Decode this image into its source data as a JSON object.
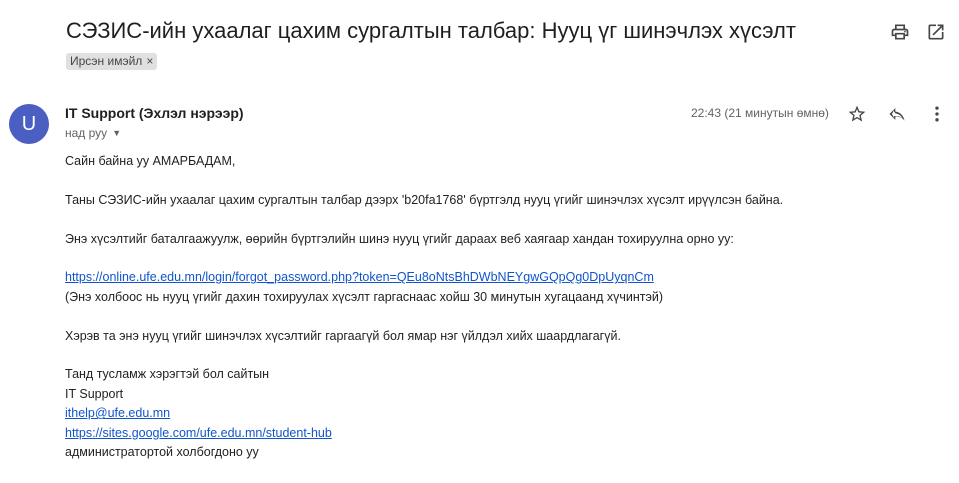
{
  "email": {
    "subject": "СЭЗИС-ийн ухаалаг цахим сургалтын талбар: Нууц үг шинэчлэх хүсэлт",
    "label_chip": "Ирсэн имэйл",
    "label_chip_remove": "×",
    "sender_initial": "U",
    "sender_name": "IT Support (Эхлэл нэрээр)",
    "to_text": "над руу",
    "timestamp": "22:43 (21 минутын өмнө)",
    "body": {
      "greeting": "Сайн байна уу АМАРБАДАМ,",
      "para1": "Таны СЭЗИС-ийн ухаалаг цахим сургалтын талбар дээрх 'b20fa1768' бүртгэлд нууц үгийг шинэчлэх хүсэлт ирүүлсэн байна.",
      "para2": "Энэ хүсэлтийг баталгаажуулж, өөрийн бүртгэлийн шинэ нууц үгийг дараах веб хаягаар хандан тохируулна орно уу:",
      "reset_link": "https://online.ufe.edu.mn/login/forgot_password.php?token=QEu8oNtsBhDWbNEYgwGQpQg0DpUyqnCm",
      "link_note": "(Энэ холбоос нь нууц үгийг дахин тохируулах хүсэлт гаргаснаас хойш 30 минутын хугацаанд хүчинтэй)",
      "para3": "Хэрэв та энэ нууц үгийг шинэчлэх хүсэлтийг гаргаагүй бол ямар нэг үйлдэл хийх шаардлагагүй.",
      "sig_line1": "Танд тусламж хэрэгтэй бол сайтын",
      "sig_line2": "IT Support",
      "sig_email": "ithelp@ufe.edu.mn",
      "sig_url": "https://sites.google.com/ufe.edu.mn/student-hub",
      "sig_line3": "администратортой холбогдоно уу"
    }
  },
  "icons": {
    "print": "print-icon",
    "open_new_window": "open-in-new-window-icon",
    "star": "star-icon",
    "reply": "reply-icon",
    "more": "more-vertical-icon",
    "dropdown": "chevron-down-icon"
  },
  "colors": {
    "avatar": "#4a5fc1",
    "link": "#1155cc",
    "chip_bg": "#e0e0e0"
  }
}
